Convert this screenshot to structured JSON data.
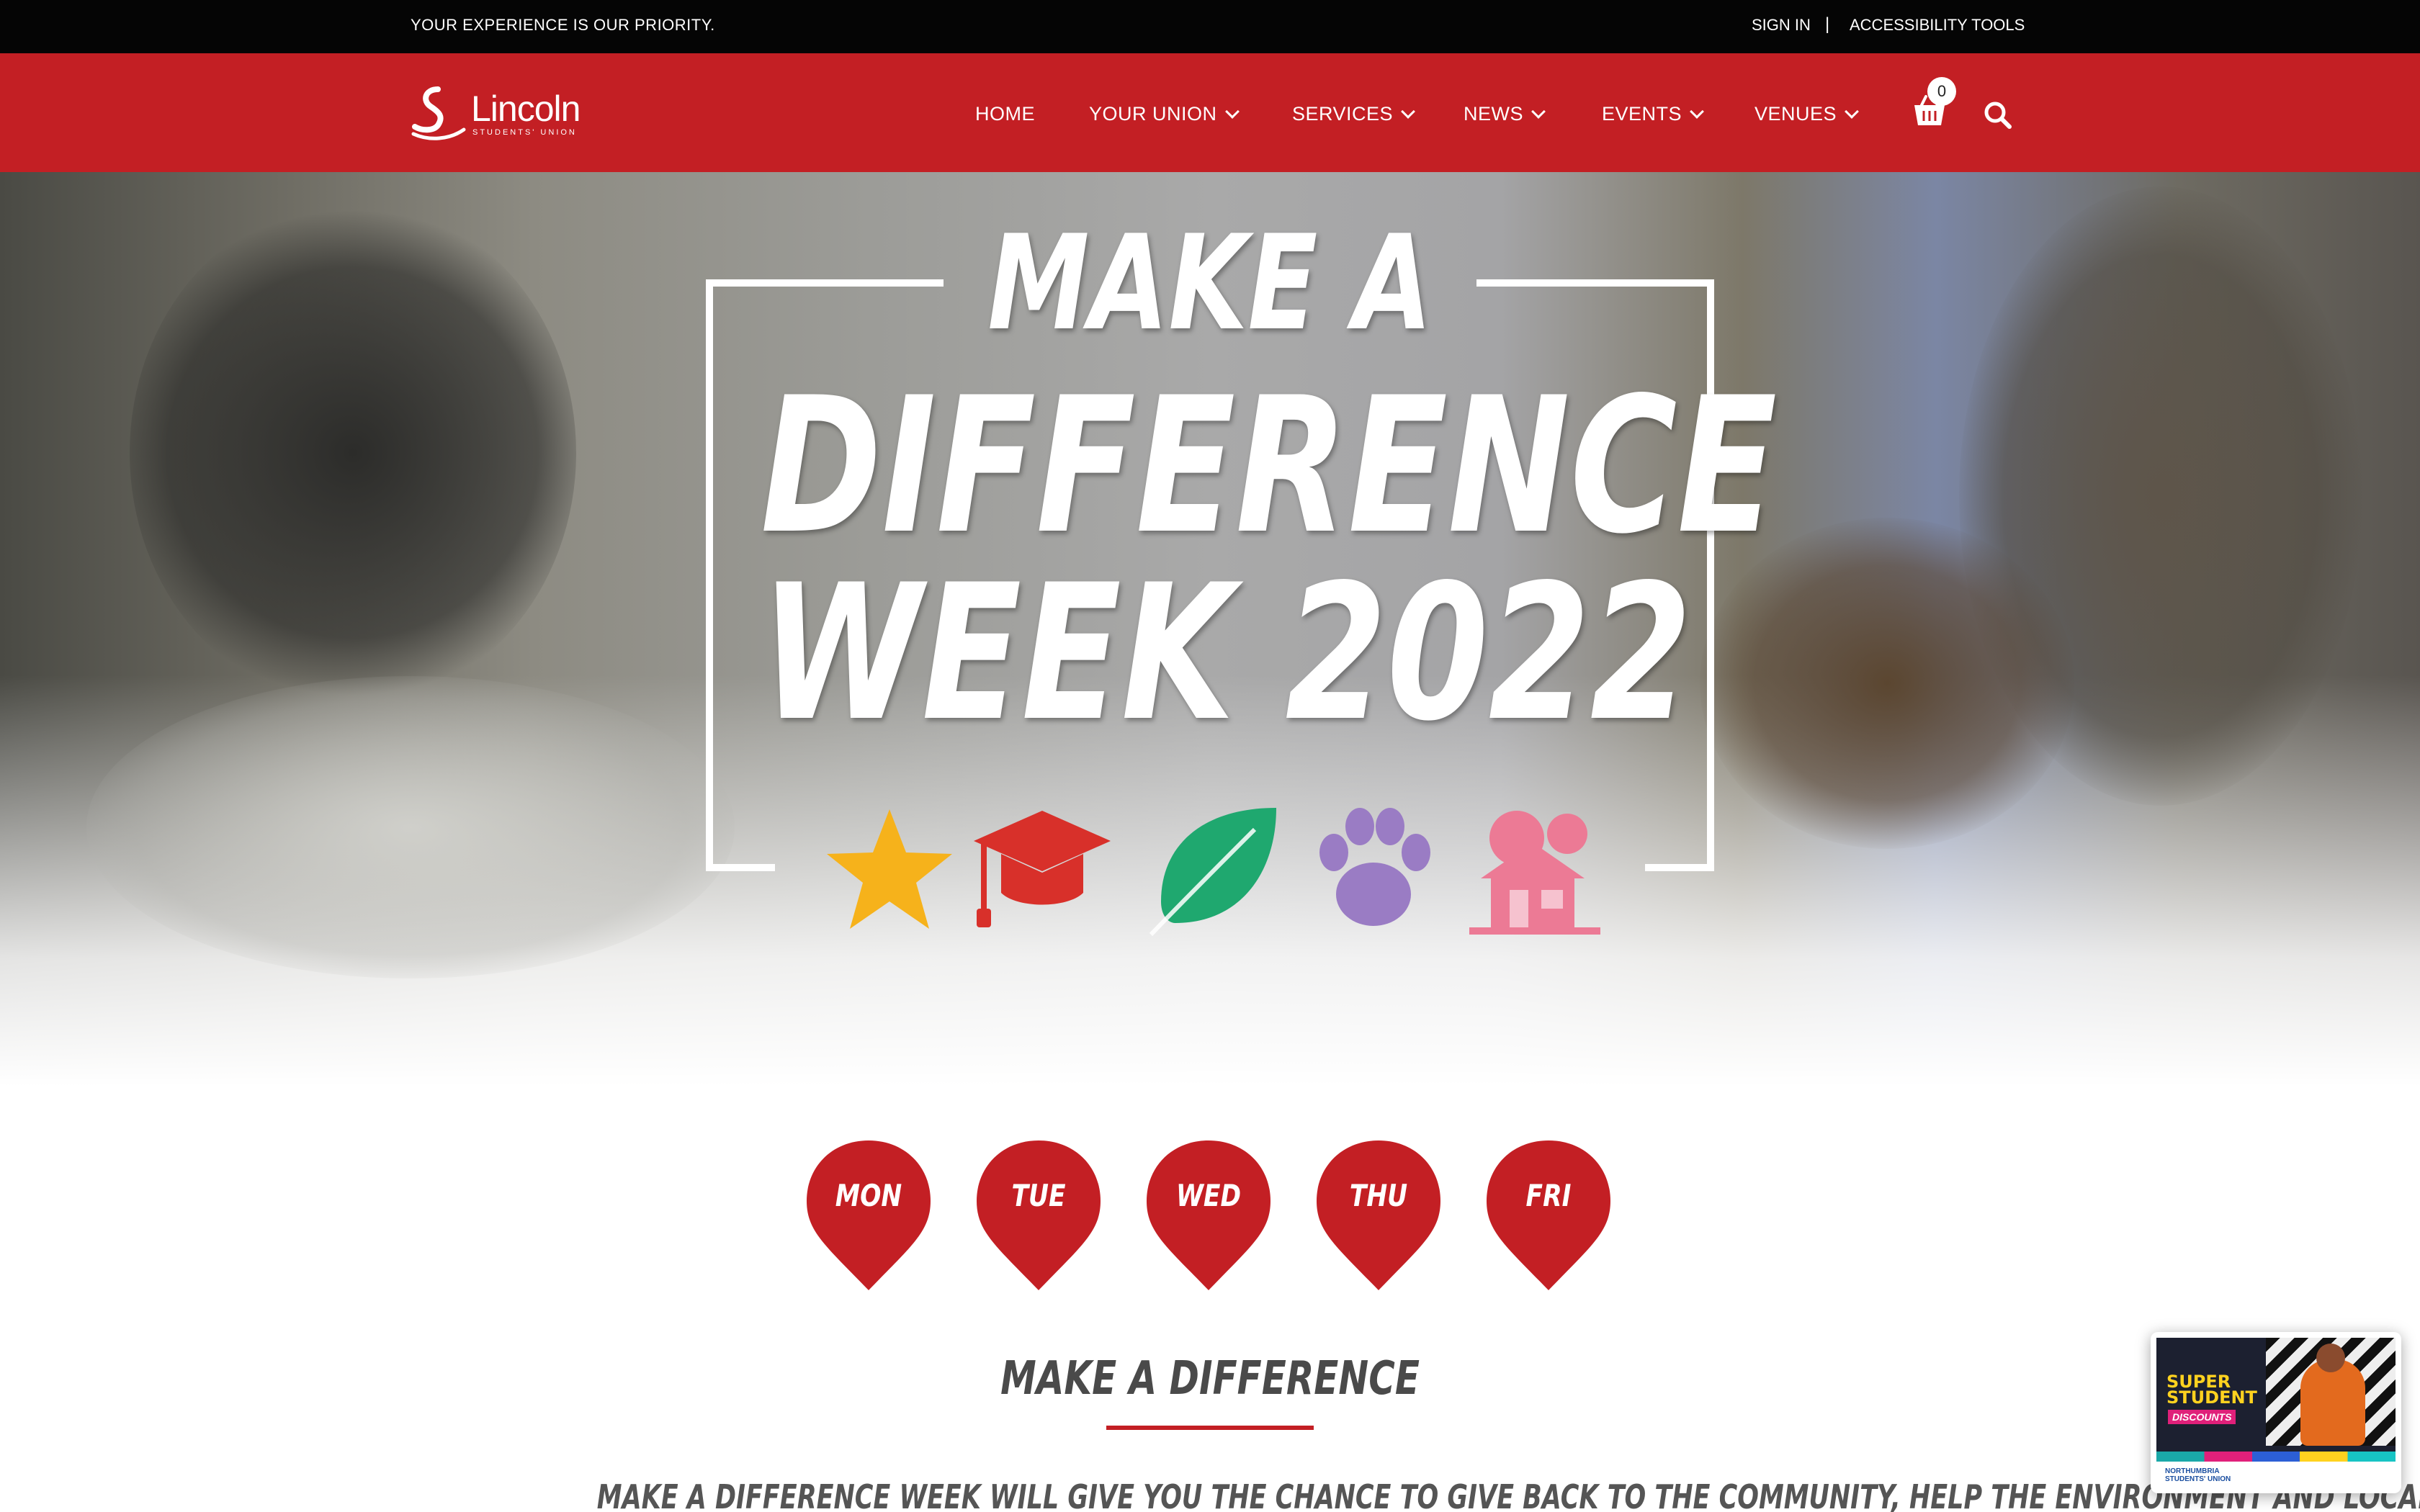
{
  "topbar": {
    "tagline": "YOUR EXPERIENCE IS OUR PRIORITY.",
    "sign_in": "SIGN IN",
    "separator": "|",
    "accessibility": "ACCESSIBILITY TOOLS"
  },
  "brand": {
    "name": "Lincoln",
    "subtitle": "STUDENTS' UNION",
    "color": "#c31f24"
  },
  "nav": {
    "items": [
      {
        "label": "HOME",
        "has_dropdown": false
      },
      {
        "label": "YOUR UNION",
        "has_dropdown": true
      },
      {
        "label": "SERVICES",
        "has_dropdown": true
      },
      {
        "label": "NEWS",
        "has_dropdown": true
      },
      {
        "label": "EVENTS",
        "has_dropdown": true
      },
      {
        "label": "VENUES",
        "has_dropdown": true
      }
    ],
    "cart_count": "0",
    "cart_icon": "basket-icon",
    "search_icon": "search-icon"
  },
  "hero": {
    "line1": "MAKE A",
    "line2": "DIFFERENCE",
    "line3": "WEEK 2022",
    "icons": [
      {
        "name": "star-icon",
        "color": "#f6b21b"
      },
      {
        "name": "graduation-cap-icon",
        "color": "#d8302a"
      },
      {
        "name": "leaf-icon",
        "color": "#1fa86f"
      },
      {
        "name": "paw-icon",
        "color": "#9a7cc4"
      },
      {
        "name": "house-icon",
        "color": "#ec7a95"
      }
    ]
  },
  "days": [
    "MON",
    "TUE",
    "WED",
    "THU",
    "FRI"
  ],
  "section": {
    "title": "MAKE A DIFFERENCE",
    "intro": "MAKE A DIFFERENCE WEEK WILL GIVE YOU THE CHANCE TO GIVE BACK TO THE COMMUNITY, HELP THE ENVIRONMENT AND LOCAL"
  },
  "widget": {
    "promo_line1": "SUPER",
    "promo_line2": "STUDENT",
    "promo_line3": "DISCOUNTS",
    "site_line1": "NORTHUMBRIA",
    "site_line2": "STUDENTS' UNION"
  }
}
